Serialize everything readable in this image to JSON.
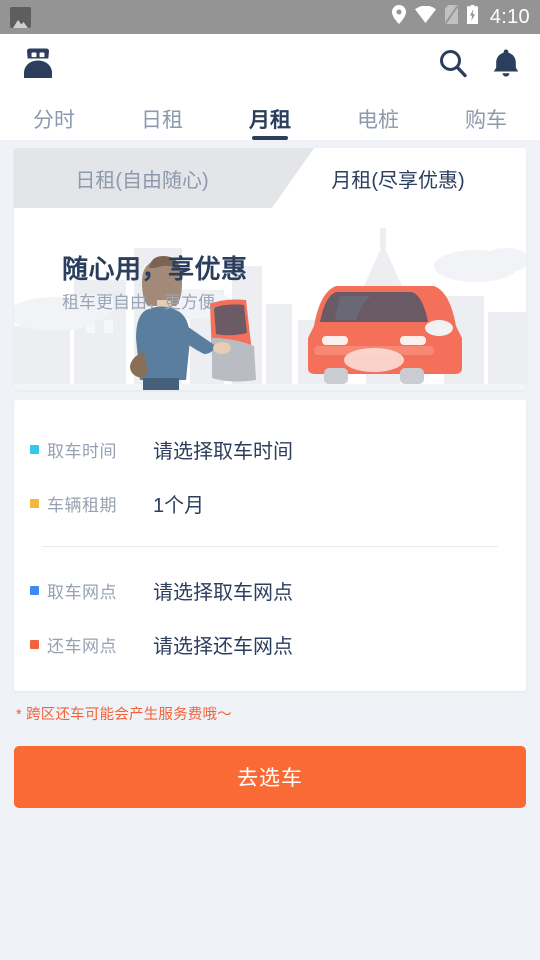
{
  "status_bar": {
    "time": "4:10",
    "icons": [
      "screenshot-icon",
      "location-icon",
      "wifi-icon",
      "no-sim-icon",
      "battery-charging-icon"
    ]
  },
  "app_bar": {
    "profile_icon": "driver-avatar-icon",
    "search_icon": "search-icon",
    "notification_icon": "bell-icon"
  },
  "top_tabs": {
    "active_index": 2,
    "items": [
      {
        "label": "分时"
      },
      {
        "label": "日租"
      },
      {
        "label": "月租"
      },
      {
        "label": "电桩"
      },
      {
        "label": "购车"
      }
    ]
  },
  "segmented": {
    "active_index": 1,
    "items": [
      {
        "label": "日租(自由随心)"
      },
      {
        "label": "月租(尽享优惠)"
      }
    ]
  },
  "banner": {
    "title": "随心用，享优惠",
    "subtitle": "租车更自由，更方便",
    "illustration": "man-beside-car-city-skyline"
  },
  "form": {
    "rows": [
      {
        "label": "取车时间",
        "value": "请选择取车时间",
        "bullet_color": "#31c8f0"
      },
      {
        "label": "车辆租期",
        "value": "1个月",
        "bullet_color": "#f6b73c"
      },
      {
        "label": "取车网点",
        "value": "请选择取车网点",
        "bullet_color": "#3d8bf2"
      },
      {
        "label": "还车网点",
        "value": "请选择还车网点",
        "bullet_color": "#f4623a"
      }
    ]
  },
  "note": "* 跨区还车可能会产生服务费哦～",
  "cta": {
    "label": "去选车"
  },
  "colors": {
    "page_background": "#eff2f7",
    "card": "#ffffff",
    "primary_text": "#2c3e5d",
    "muted_text": "#97a1b2",
    "accent_orange": "#f96a35",
    "note_red": "#f4623a",
    "inactive_segment": "#e4e5e8",
    "status_bar": "#949494"
  }
}
